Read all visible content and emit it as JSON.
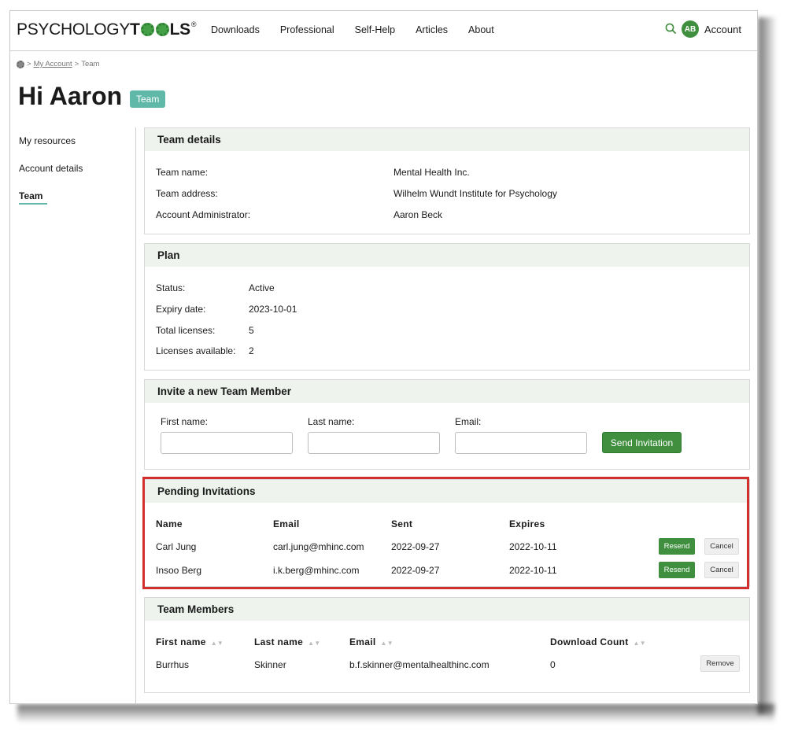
{
  "brand": {
    "logo_left": "PSYCHOLOGY",
    "logo_right_a": "T",
    "logo_right_b": "LS",
    "reg": "®",
    "accent": "#3f8f3f",
    "teal": "#5fb8a8"
  },
  "nav": [
    "Downloads",
    "Professional",
    "Self-Help",
    "Articles",
    "About"
  ],
  "header": {
    "avatar_initials": "AB",
    "account_label": "Account",
    "search_icon": "search-icon"
  },
  "breadcrumb": {
    "home_icon": "gear-icon",
    "sep1": ">",
    "link": "My Account",
    "sep2": ">",
    "current": "Team"
  },
  "page": {
    "title": "Hi Aaron",
    "badge": "Team"
  },
  "sidebar": {
    "items": [
      "My resources",
      "Account details",
      "Team"
    ],
    "active": "Team"
  },
  "team_details": {
    "heading": "Team details",
    "rows": [
      {
        "label": "Team name:",
        "value": "Mental Health Inc."
      },
      {
        "label": "Team address:",
        "value": "Wilhelm Wundt Institute for Psychology"
      },
      {
        "label": "Account Administrator:",
        "value": "Aaron Beck"
      }
    ]
  },
  "plan": {
    "heading": "Plan",
    "rows": [
      {
        "label": "Status:",
        "value": "Active"
      },
      {
        "label": "Expiry date:",
        "value": "2023-10-01"
      },
      {
        "label": "Total licenses:",
        "value": "5"
      },
      {
        "label": "Licenses available:",
        "value": "2"
      }
    ]
  },
  "invite": {
    "heading": "Invite a new Team Member",
    "first_label": "First name:",
    "last_label": "Last name:",
    "email_label": "Email:",
    "first_value": "",
    "last_value": "",
    "email_value": "",
    "send_label": "Send Invitation"
  },
  "pending": {
    "heading": "Pending Invitations",
    "columns": [
      "Name",
      "Email",
      "Sent",
      "Expires"
    ],
    "rows": [
      {
        "name": "Carl Jung",
        "email": "carl.jung@mhinc.com",
        "sent": "2022-09-27",
        "expires": "2022-10-11",
        "resend": "Resend",
        "cancel": "Cancel"
      },
      {
        "name": "Insoo Berg",
        "email": "i.k.berg@mhinc.com",
        "sent": "2022-09-27",
        "expires": "2022-10-11",
        "resend": "Resend",
        "cancel": "Cancel"
      }
    ]
  },
  "members": {
    "heading": "Team Members",
    "columns": [
      "First name",
      "Last name",
      "Email",
      "Download Count"
    ],
    "rows": [
      {
        "first": "Burrhus",
        "last": "Skinner",
        "email": "b.f.skinner@mentalhealthinc.com",
        "count": "0",
        "remove": "Remove"
      }
    ]
  }
}
